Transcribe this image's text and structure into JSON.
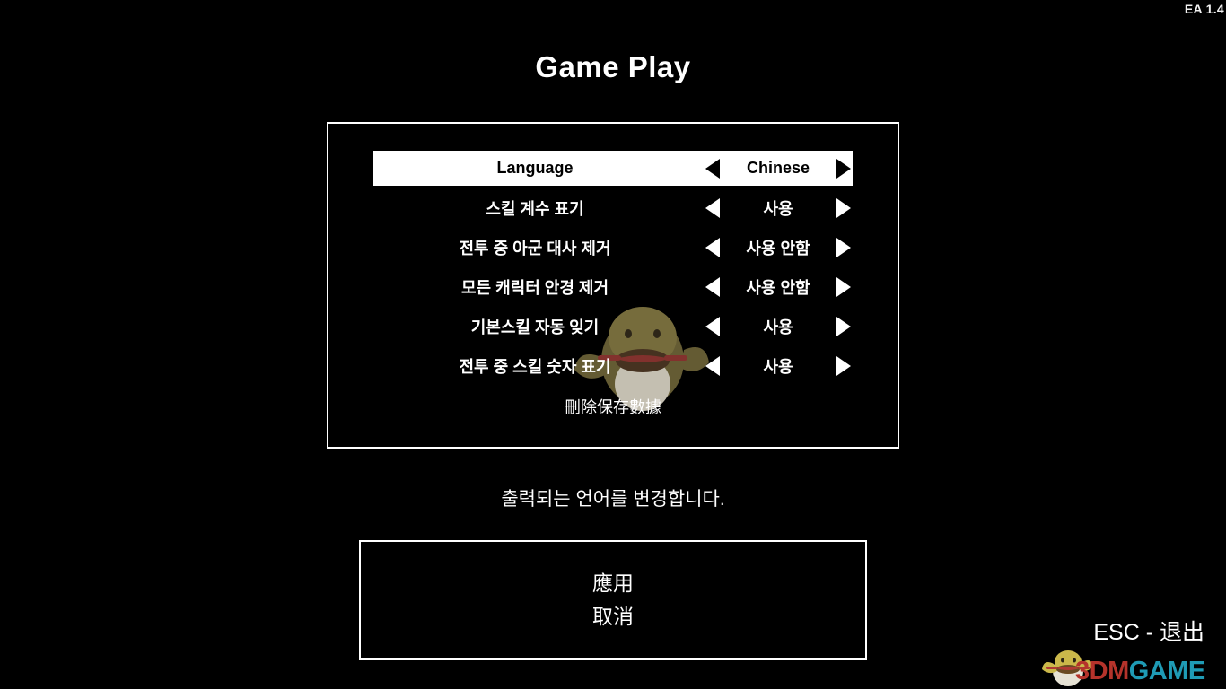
{
  "version": {
    "label": "EA 1.4"
  },
  "header": {
    "title": "Game Play"
  },
  "options_panel": {
    "rows": [
      {
        "label": "Language",
        "value": "Chinese",
        "selected": true,
        "left_arrow": "triangle-left-icon",
        "right_arrow": "triangle-right-icon"
      },
      {
        "label": "스킬 계수 표기",
        "value": "사용",
        "selected": false,
        "left_arrow": "triangle-left-icon",
        "right_arrow": "triangle-right-icon"
      },
      {
        "label": "전투 중 아군 대사 제거",
        "value": "사용 안함",
        "selected": false,
        "left_arrow": "triangle-left-icon",
        "right_arrow": "triangle-right-icon"
      },
      {
        "label": "모든 캐릭터 안경 제거",
        "value": "사용 안함",
        "selected": false,
        "left_arrow": "triangle-left-icon",
        "right_arrow": "triangle-right-icon"
      },
      {
        "label": "기본스킬 자동 잊기",
        "value": "사용",
        "selected": false,
        "left_arrow": "triangle-left-icon",
        "right_arrow": "triangle-right-icon"
      },
      {
        "label": "전투 중 스킬 숫자 표기",
        "value": "사용",
        "selected": false,
        "left_arrow": "triangle-left-icon",
        "right_arrow": "triangle-right-icon"
      }
    ],
    "delete_save_label": "刪除保存數據",
    "watermark_icon": "mascot-character-icon"
  },
  "description": {
    "text": "출력되는 언어를 변경합니다."
  },
  "actions": {
    "apply_label": "應用",
    "cancel_label": "取消"
  },
  "esc_hint": {
    "text": "ESC - 退出"
  },
  "watermark": {
    "brand_primary": "3DM",
    "brand_secondary": "GAME",
    "color_primary": "#b5332b",
    "color_secondary": "#1f9bb5",
    "mascot_icon": "3dmgame-mascot-icon"
  },
  "colors": {
    "background": "#000000",
    "foreground": "#ffffff",
    "selected_row_bg": "#ffffff",
    "selected_row_fg": "#000000"
  }
}
